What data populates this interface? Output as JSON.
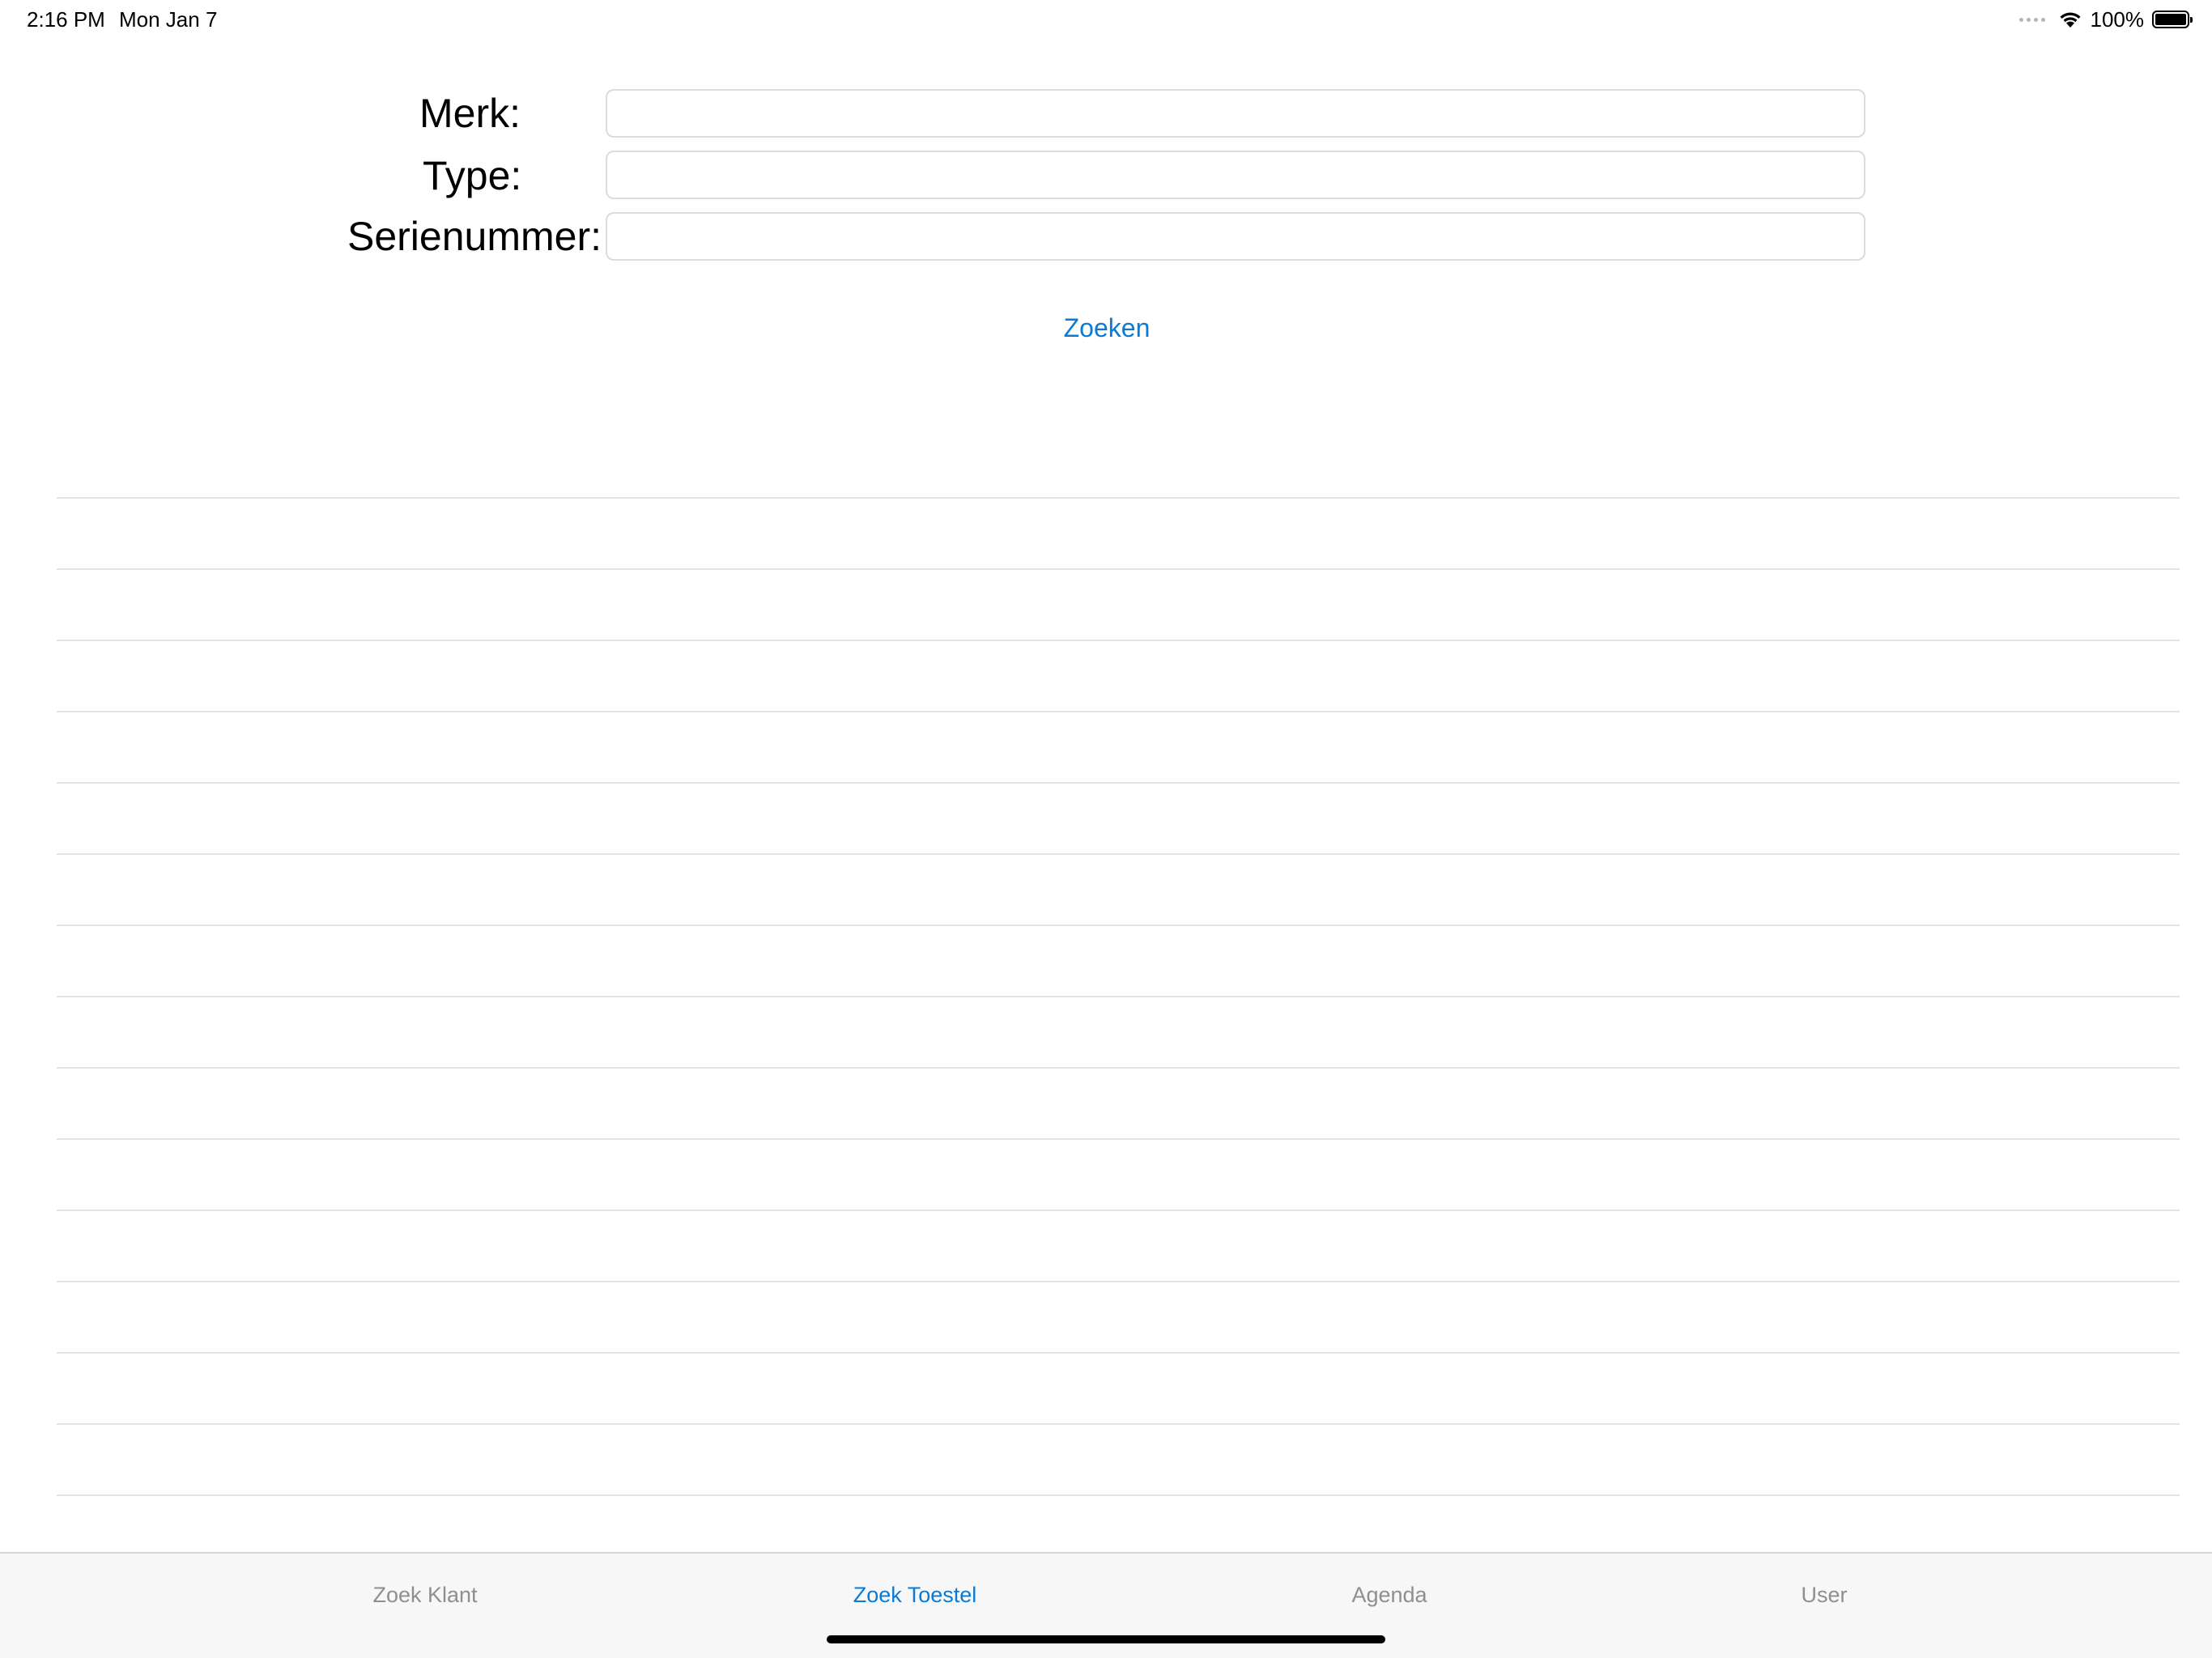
{
  "status_bar": {
    "time": "2:16 PM",
    "date": "Mon Jan 7",
    "battery_percent": "100%",
    "icons": [
      "signal-dots-icon",
      "wifi-icon",
      "battery-icon"
    ]
  },
  "form": {
    "brand_label": "Merk:",
    "brand_value": "",
    "type_label": "Type:",
    "type_value": "",
    "serial_label": "Serienummer:",
    "serial_value": "",
    "search_button": "Zoeken"
  },
  "results": {
    "rows": [
      "",
      "",
      "",
      "",
      "",
      "",
      "",
      "",
      "",
      "",
      "",
      "",
      "",
      "",
      ""
    ]
  },
  "tab_bar": {
    "tabs": [
      {
        "label": "Zoek Klant",
        "active": false
      },
      {
        "label": "Zoek Toestel",
        "active": true
      },
      {
        "label": "Agenda",
        "active": false
      },
      {
        "label": "User",
        "active": false
      }
    ]
  },
  "colors": {
    "accent": "#0a7ad8",
    "inactive_tab": "#8e8e93",
    "separator": "#e3e3e5",
    "tab_bar_bg": "#f7f7f7"
  }
}
